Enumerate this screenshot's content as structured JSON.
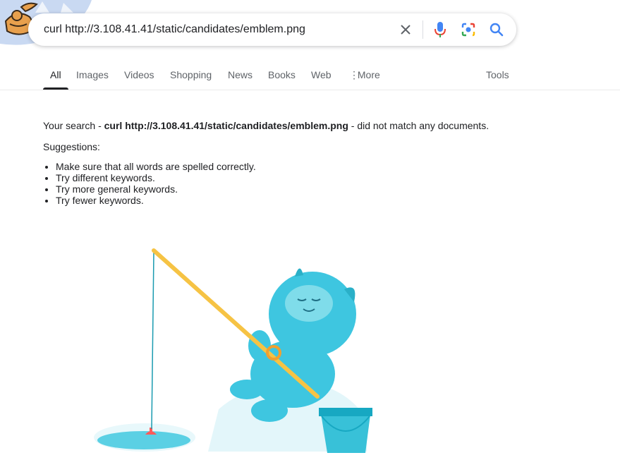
{
  "search": {
    "query": "curl http://3.108.41.41/static/candidates/emblem.png"
  },
  "tabs": [
    {
      "label": "All"
    },
    {
      "label": "Images"
    },
    {
      "label": "Videos"
    },
    {
      "label": "Shopping"
    },
    {
      "label": "News"
    },
    {
      "label": "Books"
    },
    {
      "label": "Web"
    },
    {
      "label": "More"
    }
  ],
  "tools_label": "Tools",
  "result": {
    "prefix": "Your search - ",
    "query": "curl http://3.108.41.41/static/candidates/emblem.png",
    "suffix": " - did not match any documents.",
    "suggestions_label": "Suggestions:",
    "suggestions": [
      "Make sure that all words are spelled correctly.",
      "Try different keywords.",
      "Try more general keywords.",
      "Try fewer keywords."
    ]
  },
  "icons": {
    "clear": "close-icon",
    "voice": "microphone-icon",
    "lens": "camera-lens-icon",
    "search": "search-icon",
    "more": "vertical-dots-icon"
  },
  "colors": {
    "accent_blue": "#4285f4",
    "mic_red": "#ea4335",
    "yeti": "#3ec6e0",
    "rod": "#f6c344"
  }
}
